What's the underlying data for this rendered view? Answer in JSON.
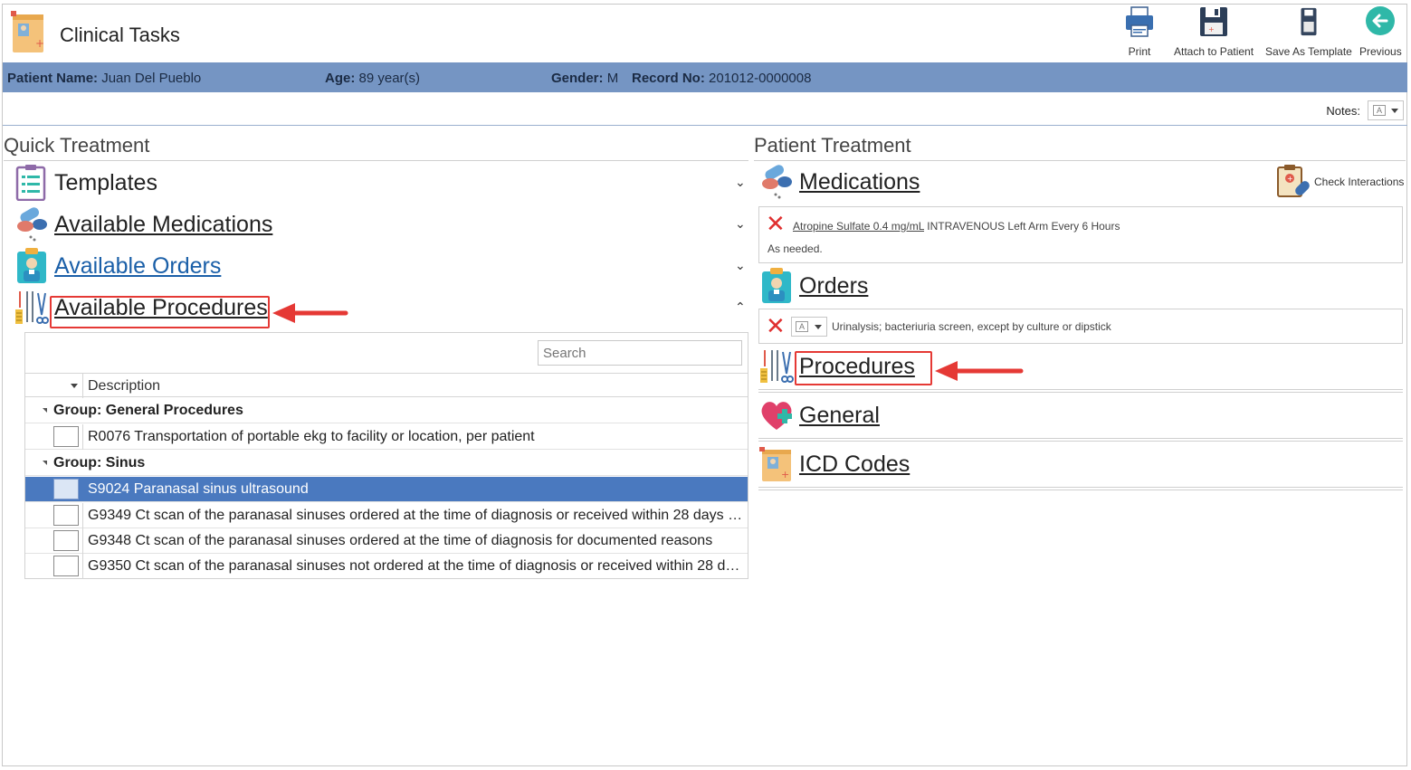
{
  "app": {
    "title": "Clinical Tasks"
  },
  "toolbar": {
    "print": "Print",
    "attach": "Attach to Patient",
    "save_template": "Save As Template",
    "previous": "Previous"
  },
  "patient": {
    "name_label": "Patient Name:",
    "name": "Juan Del Pueblo",
    "age_label": "Age:",
    "age": "89 year(s)",
    "gender_label": "Gender:",
    "gender": "M",
    "record_label": "Record No:",
    "record": "201012-0000008"
  },
  "notes": {
    "label": "Notes:"
  },
  "quick_treatment": {
    "title": "Quick Treatment",
    "templates": "Templates",
    "available_medications": "Available Medications",
    "available_orders": "Available Orders",
    "available_procedures": "Available Procedures",
    "search_placeholder": "Search",
    "column_description": "Description",
    "groups": [
      {
        "label": "Group: General Procedures",
        "rows": [
          {
            "text": "R0076 Transportation of portable ekg to facility or location, per patient"
          }
        ]
      },
      {
        "label": "Group: Sinus",
        "rows": [
          {
            "text": "S9024 Paranasal sinus ultrasound",
            "selected": true
          },
          {
            "text": "G9349 Ct scan of the paranasal sinuses ordered at the time of diagnosis or received within 28 days af..."
          },
          {
            "text": "G9348 Ct scan of the paranasal sinuses ordered at the time of diagnosis for documented reasons"
          },
          {
            "text": "G9350 Ct scan of the paranasal sinuses not ordered at the time of diagnosis or received within 28 da..."
          }
        ]
      }
    ]
  },
  "patient_treatment": {
    "title": "Patient Treatment",
    "medications": "Medications",
    "check_interactions": "Check Interactions",
    "med_item": {
      "drug": "Atropine Sulfate  0.4 mg/mL",
      "detail": " INTRAVENOUS Left Arm Every 6 Hours",
      "note": "As needed."
    },
    "orders": "Orders",
    "order_item": "Urinalysis; bacteriuria screen, except by culture or dipstick",
    "procedures": "Procedures",
    "general": "General",
    "icd_codes": "ICD Codes"
  },
  "colors": {
    "patient_bar": "#7595c3",
    "selected_row": "#4a79bf",
    "highlight": "#e53935",
    "link": "#1a5fa8"
  },
  "icons": [
    "clinical-tasks-icon",
    "printer-icon",
    "floppy-disk-icon",
    "template-disk-icon",
    "back-arrow-icon",
    "clipboard-list-icon",
    "pills-icon",
    "doctor-clipboard-icon",
    "surgical-tools-icon",
    "heart-plus-icon",
    "medical-folder-icon",
    "check-interactions-icon",
    "delete-x-icon",
    "note-icon"
  ]
}
